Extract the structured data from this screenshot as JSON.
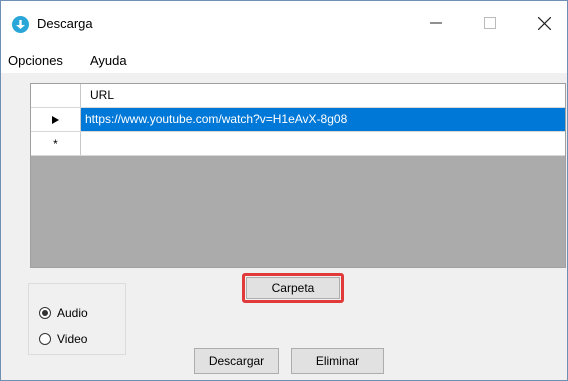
{
  "window": {
    "title": "Descarga",
    "min_glyph": "—",
    "max_glyph": "□",
    "close_glyph": "✕"
  },
  "menu": {
    "items": [
      "Opciones",
      "Ayuda"
    ]
  },
  "grid": {
    "column_header": "URL",
    "rows": [
      {
        "marker": "▶",
        "url": "https://www.youtube.com/watch?v=H1eAvX-8g08",
        "selected": true
      },
      {
        "marker": "*",
        "url": "",
        "selected": false
      }
    ],
    "header_background": "#ffffff",
    "empty_area_color": "#ababab",
    "selection_color": "#0078d7"
  },
  "format": {
    "options": [
      {
        "label": "Audio",
        "checked": true
      },
      {
        "label": "Video",
        "checked": false
      }
    ]
  },
  "buttons": {
    "folder": "Carpeta",
    "download": "Descargar",
    "delete": "Eliminar"
  },
  "highlight_color": "#e03a3a",
  "icons": {
    "app": "download-app-icon"
  }
}
